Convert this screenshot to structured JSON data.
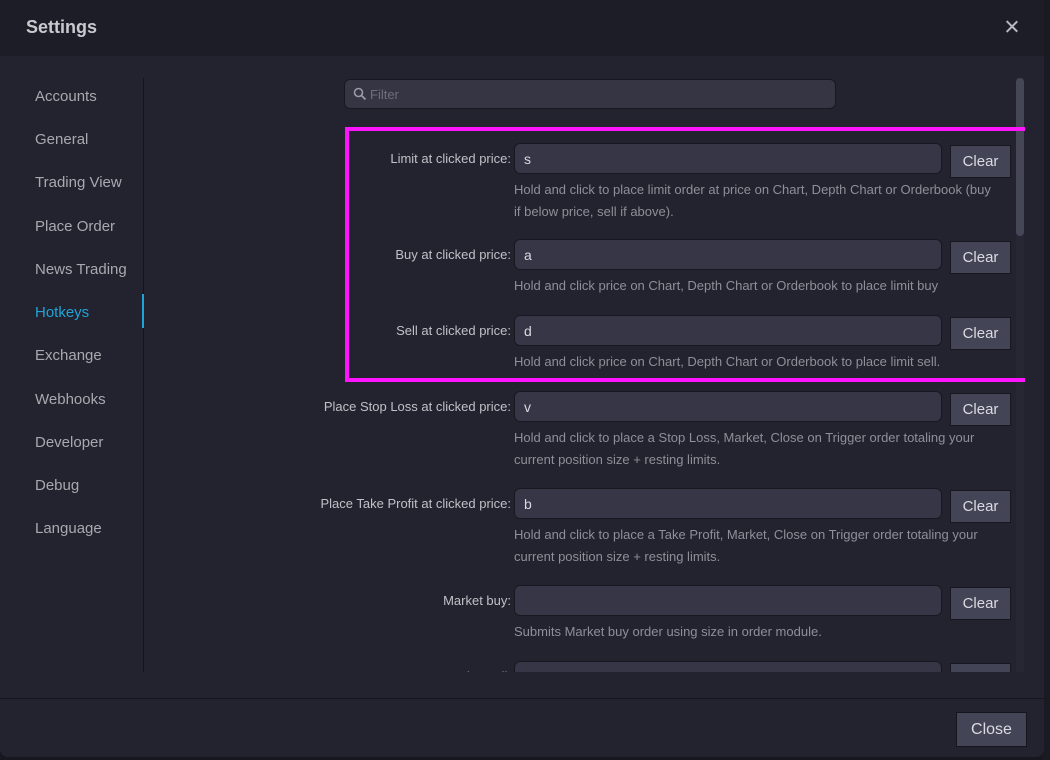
{
  "dialog": {
    "title": "Settings",
    "close_button": "Close",
    "accent_color": "#1fa3d8",
    "highlight_color": "#ff14ff"
  },
  "sidebar": {
    "items": [
      {
        "label": "Accounts",
        "active": false
      },
      {
        "label": "General",
        "active": false
      },
      {
        "label": "Trading View",
        "active": false
      },
      {
        "label": "Place Order",
        "active": false
      },
      {
        "label": "News Trading",
        "active": false
      },
      {
        "label": "Hotkeys",
        "active": true
      },
      {
        "label": "Exchange",
        "active": false
      },
      {
        "label": "Webhooks",
        "active": false
      },
      {
        "label": "Developer",
        "active": false
      },
      {
        "label": "Debug",
        "active": false
      },
      {
        "label": "Language",
        "active": false
      }
    ]
  },
  "filter": {
    "placeholder": "Filter",
    "value": ""
  },
  "hotkeys": [
    {
      "label": "Limit at clicked price:",
      "value": "s",
      "clear": "Clear",
      "description": "Hold and click to place limit order at price on Chart, Depth Chart or Orderbook (buy if below price, sell if above)."
    },
    {
      "label": "Buy at clicked price:",
      "value": "a",
      "clear": "Clear",
      "description": "Hold and click price on Chart, Depth Chart or Orderbook to place limit buy"
    },
    {
      "label": "Sell at clicked price:",
      "value": "d",
      "clear": "Clear",
      "description": "Hold and click price on Chart, Depth Chart or Orderbook to place limit sell."
    },
    {
      "label": "Place Stop Loss at clicked price:",
      "value": "v",
      "clear": "Clear",
      "description": "Hold and click to place a Stop Loss, Market, Close on Trigger order totaling your current position size + resting limits."
    },
    {
      "label": "Place Take Profit at clicked price:",
      "value": "b",
      "clear": "Clear",
      "description": "Hold and click to place a Take Profit, Market, Close on Trigger order totaling your current position size + resting limits."
    },
    {
      "label": "Market buy:",
      "value": "",
      "clear": "Clear",
      "description": "Submits Market buy order using size in order module."
    },
    {
      "label": "Market sell:",
      "value": "",
      "clear": "Clear",
      "description": ""
    }
  ]
}
